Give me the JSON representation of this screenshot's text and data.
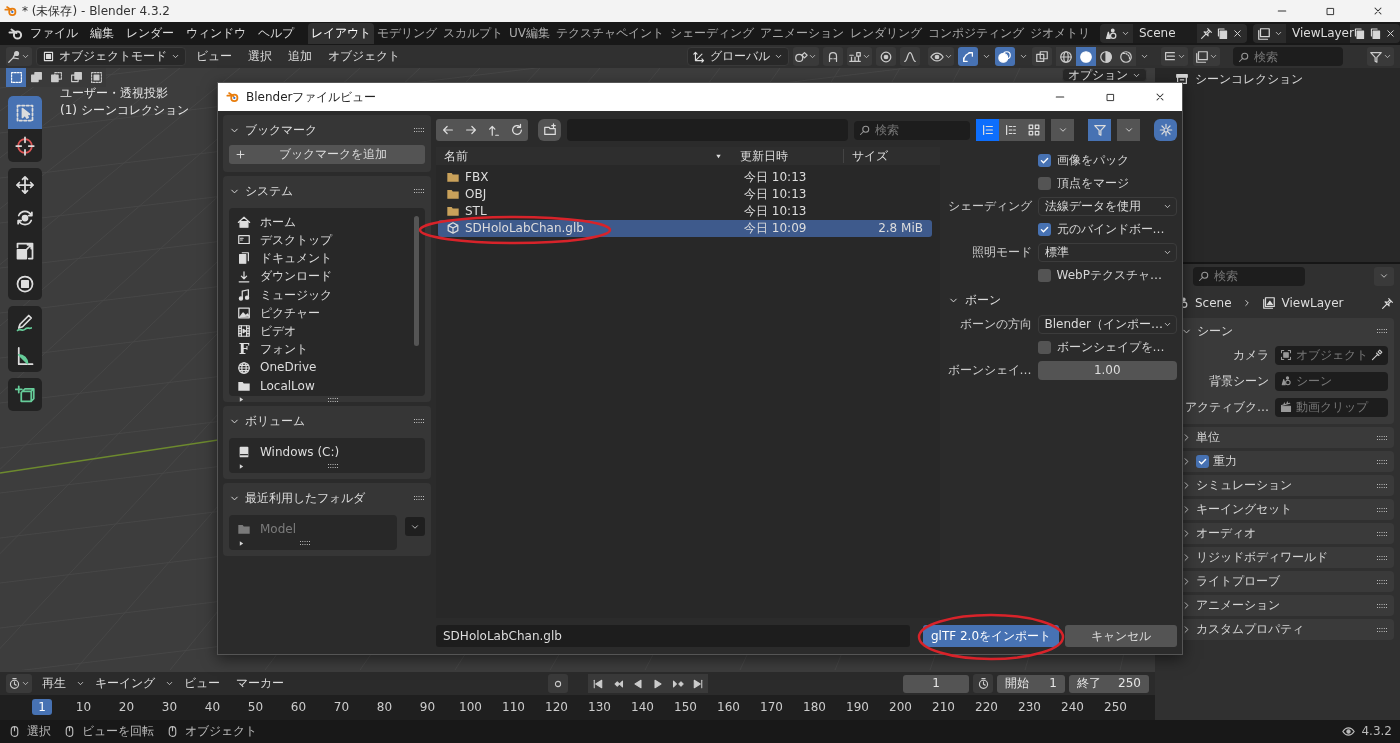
{
  "window": {
    "title": "* (未保存) - Blender 4.3.2"
  },
  "menus": [
    "ファイル",
    "編集",
    "レンダー",
    "ウィンドウ",
    "ヘルプ"
  ],
  "workspace_tabs": [
    {
      "label": "レイアウト",
      "selected": true
    },
    {
      "label": "モデリング",
      "selected": false
    },
    {
      "label": "スカルプト",
      "selected": false
    },
    {
      "label": "UV編集",
      "selected": false
    },
    {
      "label": "テクスチャペイント",
      "selected": false
    },
    {
      "label": "シェーディング",
      "selected": false
    },
    {
      "label": "アニメーション",
      "selected": false
    },
    {
      "label": "レンダリング",
      "selected": false
    },
    {
      "label": "コンポジティング",
      "selected": false
    },
    {
      "label": "ジオメトリ",
      "selected": false
    }
  ],
  "scene": "Scene",
  "view_layer": "ViewLayer",
  "viewport": {
    "mode": "オブジェクトモード",
    "menus": [
      "ビュー",
      "選択",
      "追加",
      "オブジェクト"
    ],
    "orientation": "グローバル",
    "options": "オプション",
    "overlay_text": [
      "ユーザー・透視投影",
      "(1) シーンコレクション"
    ],
    "select_modes": [
      {
        "selected": true
      },
      {
        "selected": false
      },
      {
        "selected": false
      },
      {
        "selected": false
      },
      {
        "selected": false
      }
    ],
    "shading_modes": [
      {
        "kind": "wireframe",
        "selected": false
      },
      {
        "kind": "solid",
        "selected": true
      },
      {
        "kind": "material",
        "selected": false
      },
      {
        "kind": "rendered",
        "selected": false
      }
    ],
    "tool_groups": [
      [
        {
          "kind": "select",
          "selected": true
        },
        {
          "kind": "cursor",
          "selected": false
        }
      ],
      [
        {
          "kind": "move",
          "selected": false
        },
        {
          "kind": "rotate",
          "selected": false
        },
        {
          "kind": "scale",
          "selected": false
        },
        {
          "kind": "transform",
          "selected": false
        }
      ],
      [
        {
          "kind": "annotate",
          "selected": false
        },
        {
          "kind": "measure",
          "selected": false
        }
      ],
      [
        {
          "kind": "add-cube",
          "selected": false
        }
      ]
    ]
  },
  "outliner": {
    "search_placeholder": "検索",
    "root": "シーンコレクション"
  },
  "properties": {
    "search_placeholder": "検索",
    "breadcrumb": [
      "Scene",
      "ViewLayer"
    ],
    "sections": [
      {
        "kind": "fields",
        "title": "シーン",
        "expanded": true,
        "fields": [
          {
            "kind": "object",
            "label": "カメラ",
            "placeholder": "オブジェクト"
          },
          {
            "kind": "scene",
            "label": "背景シーン",
            "placeholder": "シーン"
          },
          {
            "kind": "clip",
            "label": "アクティブク…",
            "placeholder": "動画クリップ"
          }
        ]
      },
      {
        "kind": "plain",
        "title": "単位",
        "expanded": false
      },
      {
        "kind": "checkbox",
        "title": "重力",
        "expanded": false,
        "checked": true
      },
      {
        "kind": "plain",
        "title": "シミュレーション",
        "expanded": false
      },
      {
        "kind": "plain",
        "title": "キーイングセット",
        "expanded": false
      },
      {
        "kind": "plain",
        "title": "オーディオ",
        "expanded": false
      },
      {
        "kind": "plain",
        "title": "リジッドボディワールド",
        "expanded": false
      },
      {
        "kind": "plain",
        "title": "ライトプローブ",
        "expanded": false
      },
      {
        "kind": "plain",
        "title": "アニメーション",
        "expanded": false
      },
      {
        "kind": "plain",
        "title": "カスタムプロパティ",
        "expanded": false
      }
    ]
  },
  "timeline": {
    "menus": [
      "再生",
      "キーイング",
      "ビュー",
      "マーカー"
    ],
    "current_frame": "1",
    "start_label": "開始",
    "start": "1",
    "end_label": "終了",
    "end": "250",
    "ticks": [
      {
        "label": "1",
        "selected": true
      },
      {
        "label": "10",
        "selected": false
      },
      {
        "label": "20",
        "selected": false
      },
      {
        "label": "30",
        "selected": false
      },
      {
        "label": "40",
        "selected": false
      },
      {
        "label": "50",
        "selected": false
      },
      {
        "label": "60",
        "selected": false
      },
      {
        "label": "70",
        "selected": false
      },
      {
        "label": "80",
        "selected": false
      },
      {
        "label": "90",
        "selected": false
      },
      {
        "label": "100",
        "selected": false
      },
      {
        "label": "110",
        "selected": false
      },
      {
        "label": "120",
        "selected": false
      },
      {
        "label": "130",
        "selected": false
      },
      {
        "label": "140",
        "selected": false
      },
      {
        "label": "150",
        "selected": false
      },
      {
        "label": "160",
        "selected": false
      },
      {
        "label": "170",
        "selected": false
      },
      {
        "label": "180",
        "selected": false
      },
      {
        "label": "190",
        "selected": false
      },
      {
        "label": "200",
        "selected": false
      },
      {
        "label": "210",
        "selected": false
      },
      {
        "label": "220",
        "selected": false
      },
      {
        "label": "230",
        "selected": false
      },
      {
        "label": "240",
        "selected": false
      },
      {
        "label": "250",
        "selected": false
      }
    ]
  },
  "status_bar": {
    "items": [
      "選択",
      "ビューを回転",
      "オブジェクト"
    ],
    "version": "4.3.2"
  },
  "dialog": {
    "title": "Blenderファイルビュー",
    "sidebar": [
      {
        "title": "ブックマーク",
        "expanded": true,
        "button": "ブックマークを追加"
      },
      {
        "title": "システム",
        "expanded": true,
        "items": [
          {
            "kind": "home",
            "label": "ホーム",
            "disabled": false
          },
          {
            "kind": "desktop",
            "label": "デスクトップ",
            "disabled": false
          },
          {
            "kind": "document",
            "label": "ドキュメント",
            "disabled": false
          },
          {
            "kind": "download",
            "label": "ダウンロード",
            "disabled": false
          },
          {
            "kind": "music",
            "label": "ミュージック",
            "disabled": false
          },
          {
            "kind": "picture",
            "label": "ピクチャー",
            "disabled": false
          },
          {
            "kind": "video",
            "label": "ビデオ",
            "disabled": false
          },
          {
            "kind": "font",
            "icon": "F",
            "label": "フォント",
            "disabled": false
          },
          {
            "kind": "globe",
            "label": "OneDrive",
            "disabled": false
          },
          {
            "kind": "folder",
            "label": "LocalLow",
            "disabled": false
          }
        ]
      },
      {
        "title": "ボリューム",
        "expanded": true,
        "items": [
          {
            "kind": "drive",
            "label": "Windows (C:)",
            "disabled": false
          }
        ]
      },
      {
        "title": "最近利用したフォルダ",
        "expanded": true,
        "items": [
          {
            "kind": "folder",
            "label": "Model",
            "disabled": true
          }
        ]
      }
    ],
    "search_placeholder": "検索",
    "columns": [
      "名前",
      "更新日時",
      "サイズ"
    ],
    "files": [
      {
        "kind": "folder",
        "name": "FBX",
        "modified": "今日 10:13",
        "selected": false
      },
      {
        "kind": "folder",
        "name": "OBJ",
        "modified": "今日 10:13",
        "selected": false
      },
      {
        "kind": "folder",
        "name": "STL",
        "modified": "今日 10:13",
        "selected": false
      },
      {
        "kind": "file",
        "name": "SDHoloLabChan.glb",
        "modified": "今日 10:09",
        "size": "2.8 MiB",
        "selected": true
      }
    ],
    "filename": "SDHoloLabChan.glb",
    "import_button": "glTF 2.0をインポート",
    "cancel_button": "キャンセル",
    "options": [
      {
        "kind": "checkbox",
        "label": "画像をパック",
        "checked": true
      },
      {
        "kind": "checkbox",
        "label": "頂点をマージ",
        "checked": false
      },
      {
        "kind": "select",
        "label": "シェーディング",
        "value": "法線データを使用"
      },
      {
        "kind": "checkbox",
        "label": "元のバインドボー…",
        "checked": true
      },
      {
        "kind": "select",
        "label": "照明モード",
        "value": "標準"
      },
      {
        "kind": "checkbox",
        "label": "WebPテクスチャ…",
        "checked": false
      },
      {
        "kind": "heading",
        "label": "ボーン",
        "expanded": true
      },
      {
        "kind": "select",
        "label": "ボーンの方向",
        "value": "Blender（インポー…"
      },
      {
        "kind": "checkbox",
        "label": "ボーンシェイプを…",
        "checked": false
      },
      {
        "kind": "number",
        "label": "ボーンシェイ…",
        "value": "1.00"
      }
    ]
  }
}
